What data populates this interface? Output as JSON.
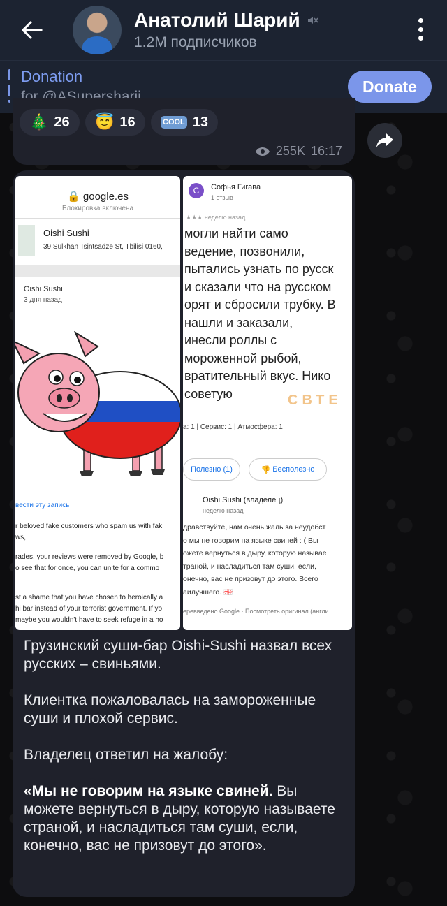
{
  "header": {
    "title": "Анатолий Шарий",
    "subscribers": "1.2M подписчиков"
  },
  "donation": {
    "title": "Donation",
    "subtitle": "for @ASupersharij",
    "button": "Donate"
  },
  "reactions": [
    {
      "emoji": "🎄",
      "count": "26"
    },
    {
      "emoji": "😇",
      "count": "16"
    },
    {
      "emoji": "COOL",
      "count": "13"
    }
  ],
  "prev_message": {
    "views": "255K",
    "time": "16:17"
  },
  "left_screenshot": {
    "url": "google.es",
    "lock_note": "Блокировка включена",
    "business": "Oishi Sushi",
    "address": "39 Sulkhan Tsintsadze St, Tbilisi 0160,",
    "reviewer": "Oishi Sushi",
    "review_time": "3 дня назад",
    "translate_link": "вести эту запись",
    "lines": [
      "r beloved fake customers who spam us with fak",
      "ws,",
      "rades, your reviews were removed by Google, b",
      "o see that for once, you can unite for a commo",
      "st a shame that you have chosen to heroically a",
      "hi bar instead of your terrorist government. If yo",
      "maybe you wouldn't have to seek refuge in a ho"
    ]
  },
  "right_screenshot": {
    "avatar_letter": "С",
    "reviewer": "Софья Гигава",
    "reviews_count": "1 отзыв",
    "time": "неделю назад",
    "big_text": [
      "могли найти само",
      "ведение, позвонили,",
      "пытались узнать по русск",
      "и сказали что на русском",
      "орят и сбросили трубку. В",
      "нашли и заказали,",
      "инесли роллы с",
      "мороженной рыбой,",
      "вратительный вкус. Нико",
      "советую"
    ],
    "watermark": "СВТЕ",
    "ratings": "а: 1 | Сервис: 1 | Атмосфера: 1",
    "useful": "Полезно (1)",
    "useless": "Бесполезно",
    "owner": "Oishi Sushi (владелец)",
    "owner_time": "неделю назад",
    "owner_lines": [
      "дравствуйте, нам очень жаль за неудобст",
      "о мы не говорим на языке свиней : ( Вы",
      "ожете вернуться в дыру, которую называе",
      "траной, и насладиться там суши, если,",
      "онечно, вас не призовут до этого. Всего",
      "аилучшего. 🇬🇪"
    ],
    "footer": "еревведено Google · Посмотреть оригинал (англи"
  },
  "message": {
    "p1": "Грузинский суши-бар Oishi-Sushi назвал всех русских – свиньями.",
    "p2": "Клиентка пожаловалась на замороженные суши и плохой сервис.",
    "p3": "Владелец ответил на жалобу:",
    "quote_bold": "«Мы не говорим на языке свиней.",
    "quote_rest": " Вы можете вернуться в дыру, которую называете страной, и насладиться там суши, если, конечно, вас не призовут до этого»."
  }
}
